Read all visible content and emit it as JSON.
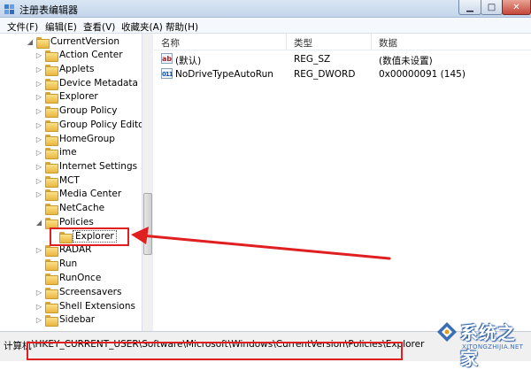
{
  "window": {
    "title": "注册表编辑器",
    "controls": {
      "minimize": "▁",
      "maximize": "□",
      "close": "✕"
    }
  },
  "menu": [
    "文件(F)",
    "编辑(E)",
    "查看(V)",
    "收藏夹(A)",
    "帮助(H)"
  ],
  "tree": {
    "parent": {
      "label": "CurrentVersion",
      "expander": "◢"
    },
    "items": [
      {
        "label": "Action Center",
        "expander": "▷"
      },
      {
        "label": "Applets",
        "expander": "▷"
      },
      {
        "label": "Device Metadata",
        "expander": "▷"
      },
      {
        "label": "Explorer",
        "expander": "▷"
      },
      {
        "label": "Group Policy",
        "expander": "▷"
      },
      {
        "label": "Group Policy Editor",
        "expander": "▷"
      },
      {
        "label": "HomeGroup",
        "expander": "▷"
      },
      {
        "label": "ime",
        "expander": "▷"
      },
      {
        "label": "Internet Settings",
        "expander": "▷"
      },
      {
        "label": "MCT",
        "expander": "▷"
      },
      {
        "label": "Media Center",
        "expander": "▷"
      },
      {
        "label": "NetCache",
        "expander": ""
      },
      {
        "label": "Policies",
        "expander": "◢"
      },
      {
        "label": "Explorer",
        "expander": "",
        "selected": true
      },
      {
        "label": "RADAR",
        "expander": "▷"
      },
      {
        "label": "Run",
        "expander": ""
      },
      {
        "label": "RunOnce",
        "expander": ""
      },
      {
        "label": "Screensavers",
        "expander": "▷"
      },
      {
        "label": "Shell Extensions",
        "expander": "▷"
      },
      {
        "label": "Sidebar",
        "expander": "▷"
      }
    ]
  },
  "columns": {
    "name": "名称",
    "type": "类型",
    "data": "数据"
  },
  "values": [
    {
      "icon": "ab",
      "name": "(默认)",
      "type": "REG_SZ",
      "data": "(数值未设置)"
    },
    {
      "icon": "011",
      "name": "NoDriveTypeAutoRun",
      "type": "REG_DWORD",
      "data": "0x00000091 (145)"
    }
  ],
  "status": {
    "prefix": "计算机",
    "path": "\\HKEY_CURRENT_USER\\Software\\Microsoft\\Windows\\CurrentVersion\\Policies\\Explorer"
  },
  "watermark": {
    "text": "系统之家",
    "sub": "XITONGZHIJIA.NET"
  },
  "colors": {
    "annotation_red": "#e02020",
    "watermark_blue": "#3b6fb5"
  }
}
